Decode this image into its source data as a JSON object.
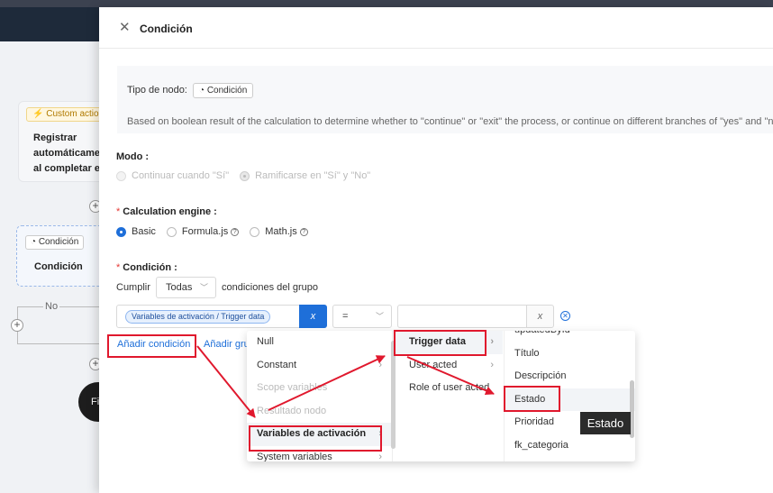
{
  "canvas": {
    "card1": {
      "tag": "Custom action",
      "text": "Registrar automáticamente al completar el"
    },
    "card2": {
      "tag": "Condición",
      "text": "Condición"
    },
    "no_label": "No",
    "dark_node": "Fi"
  },
  "drawer": {
    "title": "Condición",
    "node_type_label": "Tipo de nodo:",
    "node_type_tag": "Condición",
    "description": "Based on boolean result of the calculation to determine whether to \"continue\" or \"exit\" the process, or continue on different branches of \"yes\" and \"no\".",
    "mode": {
      "label": "Modo",
      "options": [
        "Continuar cuando \"Sí\"",
        "Ramificarse en \"Sí\" y \"No\""
      ],
      "selected": 1
    },
    "engine": {
      "label": "Calculation engine",
      "options": [
        "Basic",
        "Formula.js",
        "Math.js"
      ],
      "selected": 0
    },
    "condition": {
      "label": "Condición",
      "cumplir": "Cumplir",
      "group_select": "Todas",
      "suffix": "condiciones del grupo",
      "variable_chip": "Variables de activación / Trigger data",
      "x_label": "x",
      "operator": "=",
      "value": "",
      "add_condition": "Añadir condición",
      "add_group": "Añadir grupo"
    }
  },
  "cascader": {
    "col1": [
      {
        "label": "Null",
        "disabled": false,
        "arrow": false
      },
      {
        "label": "Constant",
        "disabled": false,
        "arrow": true
      },
      {
        "label": "Scope variables",
        "disabled": true,
        "arrow": false
      },
      {
        "label": "Resultado nodo",
        "disabled": true,
        "arrow": false
      },
      {
        "label": "Variables de activación",
        "disabled": false,
        "arrow": true,
        "active": true
      },
      {
        "label": "System variables",
        "disabled": false,
        "arrow": true
      }
    ],
    "col2": [
      {
        "label": "Trigger data",
        "arrow": true,
        "active": true
      },
      {
        "label": "User acted",
        "arrow": true
      },
      {
        "label": "Role of user acted",
        "arrow": false
      }
    ],
    "col3": [
      "updatedById",
      "Título",
      "Descripción",
      "Estado",
      "Prioridad",
      "fk_categoria"
    ],
    "col3_hover": 3
  },
  "tooltip": "Estado",
  "colors": {
    "primary": "#1e6fd9",
    "annotation": "#e0182d",
    "required": "#e53935"
  }
}
